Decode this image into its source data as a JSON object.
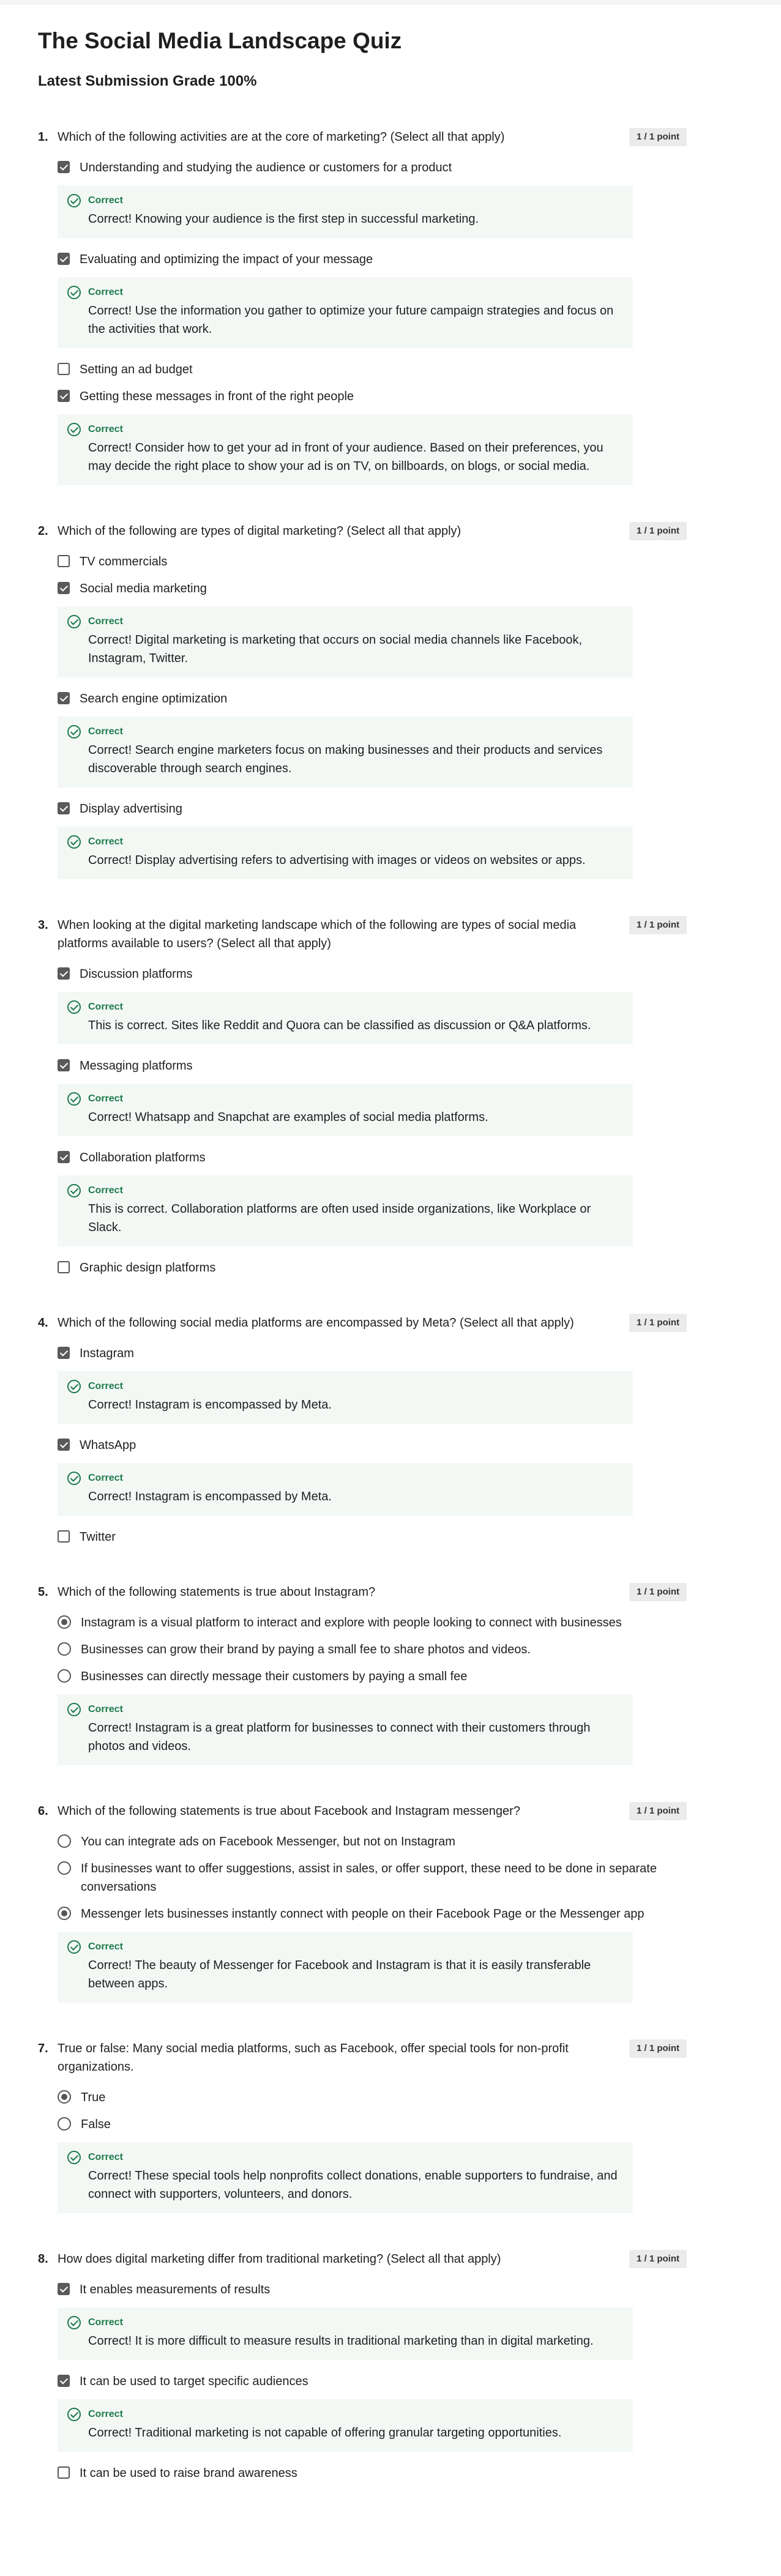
{
  "quiz": {
    "title": "The Social Media Landscape Quiz",
    "grade": "Latest Submission Grade 100%",
    "questions": [
      {
        "num": "1.",
        "text": "Which of the following activities are at the core of marketing? (Select all that apply)",
        "points": "1 / 1 point",
        "type": "checkbox",
        "options": [
          {
            "label": "Understanding and studying the audience or customers for a product",
            "checked": true,
            "feedback_label": "Correct",
            "feedback": "Correct! Knowing your audience is the first step in successful marketing."
          },
          {
            "label": "Evaluating and optimizing the impact of your message",
            "checked": true,
            "feedback_label": "Correct",
            "feedback": "Correct! Use the information you gather to optimize your future campaign strategies and focus on the activities that work."
          },
          {
            "label": "Setting an ad budget",
            "checked": false
          },
          {
            "label": "Getting these messages in front of the right people",
            "checked": true,
            "feedback_label": "Correct",
            "feedback": "Correct!  Consider how to get your ad in front of your audience. Based on their preferences, you may decide the right place to show your ad is on TV, on billboards, on blogs, or social media."
          }
        ]
      },
      {
        "num": "2.",
        "text": "Which of the following are types of digital marketing? (Select all that apply)",
        "points": "1 / 1 point",
        "type": "checkbox",
        "options": [
          {
            "label": "TV commercials",
            "checked": false
          },
          {
            "label": "Social media marketing",
            "checked": true,
            "feedback_label": "Correct",
            "feedback": "Correct! Digital marketing is marketing that occurs on social media channels like Facebook, Instagram, Twitter."
          },
          {
            "label": "Search engine optimization",
            "checked": true,
            "feedback_label": "Correct",
            "feedback": "Correct! Search engine marketers focus on making businesses and their products and services discoverable through search engines."
          },
          {
            "label": "Display advertising",
            "checked": true,
            "feedback_label": "Correct",
            "feedback": "Correct! Display advertising refers to advertising with images or videos on websites or apps."
          }
        ]
      },
      {
        "num": "3.",
        "text": "When looking at the digital marketing landscape which of the following are types of social media platforms available to users? (Select all that apply)",
        "points": "1 / 1 point",
        "type": "checkbox",
        "options": [
          {
            "label": "Discussion platforms",
            "checked": true,
            "feedback_label": "Correct",
            "feedback": "This is correct. Sites like Reddit and Quora can be classified as discussion or Q&A platforms."
          },
          {
            "label": "Messaging platforms",
            "checked": true,
            "feedback_label": "Correct",
            "feedback": "Correct! Whatsapp and Snapchat are examples of social media platforms."
          },
          {
            "label": "Collaboration platforms",
            "checked": true,
            "feedback_label": "Correct",
            "feedback": "This is correct. Collaboration platforms are often used inside organizations, like Workplace or Slack."
          },
          {
            "label": "Graphic design platforms",
            "checked": false
          }
        ]
      },
      {
        "num": "4.",
        "text": "Which of the following social media platforms are encompassed by Meta? (Select all that apply)",
        "points": "1 / 1 point",
        "type": "checkbox",
        "options": [
          {
            "label": "Instagram",
            "checked": true,
            "feedback_label": "Correct",
            "feedback": "Correct! Instagram is encompassed by Meta."
          },
          {
            "label": "WhatsApp",
            "checked": true,
            "feedback_label": "Correct",
            "feedback": "Correct! Instagram is encompassed by Meta."
          },
          {
            "label": "Twitter",
            "checked": false
          }
        ]
      },
      {
        "num": "5.",
        "text": "Which of the following statements is true about Instagram?",
        "points": "1 / 1 point",
        "type": "radio",
        "options": [
          {
            "label": "Instagram is a visual platform to interact and explore with people looking to connect with businesses",
            "checked": true
          },
          {
            "label": "Businesses can grow their brand by paying a small fee to share photos and videos.",
            "checked": false
          },
          {
            "label": "Businesses can directly message their customers by paying a small fee",
            "checked": false,
            "feedback_label": "Correct",
            "feedback": "Correct! Instagram is a great platform for businesses to connect with their customers through photos and videos."
          }
        ]
      },
      {
        "num": "6.",
        "text": "Which of the following statements is true about Facebook and Instagram messenger?",
        "points": "1 / 1 point",
        "type": "radio",
        "options": [
          {
            "label": "You can integrate ads on Facebook Messenger, but not on Instagram",
            "checked": false
          },
          {
            "label": "If businesses want to offer suggestions, assist in sales, or offer support, these need to be done in separate conversations",
            "checked": false
          },
          {
            "label": "Messenger lets businesses instantly connect with people on their Facebook Page or the Messenger app",
            "checked": true,
            "feedback_label": "Correct",
            "feedback": "Correct! The beauty of Messenger for Facebook and Instagram is that it is easily transferable between apps."
          }
        ]
      },
      {
        "num": "7.",
        "text": "True or false: Many social media platforms, such as Facebook, offer special tools for non-profit organizations.",
        "points": "1 / 1 point",
        "type": "radio",
        "options": [
          {
            "label": "True",
            "checked": true
          },
          {
            "label": "False",
            "checked": false,
            "feedback_label": "Correct",
            "feedback": "Correct! These special tools help nonprofits collect donations, enable supporters to fundraise, and connect with supporters, volunteers, and donors."
          }
        ]
      },
      {
        "num": "8.",
        "text": "How does digital marketing differ from traditional marketing? (Select all that apply)",
        "points": "1 / 1 point",
        "type": "checkbox",
        "options": [
          {
            "label": "It enables measurements of results",
            "checked": true,
            "feedback_label": "Correct",
            "feedback": "Correct! It is more difficult to measure results in traditional marketing than in digital marketing."
          },
          {
            "label": "It can be used to target specific audiences",
            "checked": true,
            "feedback_label": "Correct",
            "feedback": "Correct! Traditional marketing is not capable of offering granular targeting opportunities."
          },
          {
            "label": "It can be used to raise brand awareness",
            "checked": false
          }
        ]
      }
    ]
  }
}
